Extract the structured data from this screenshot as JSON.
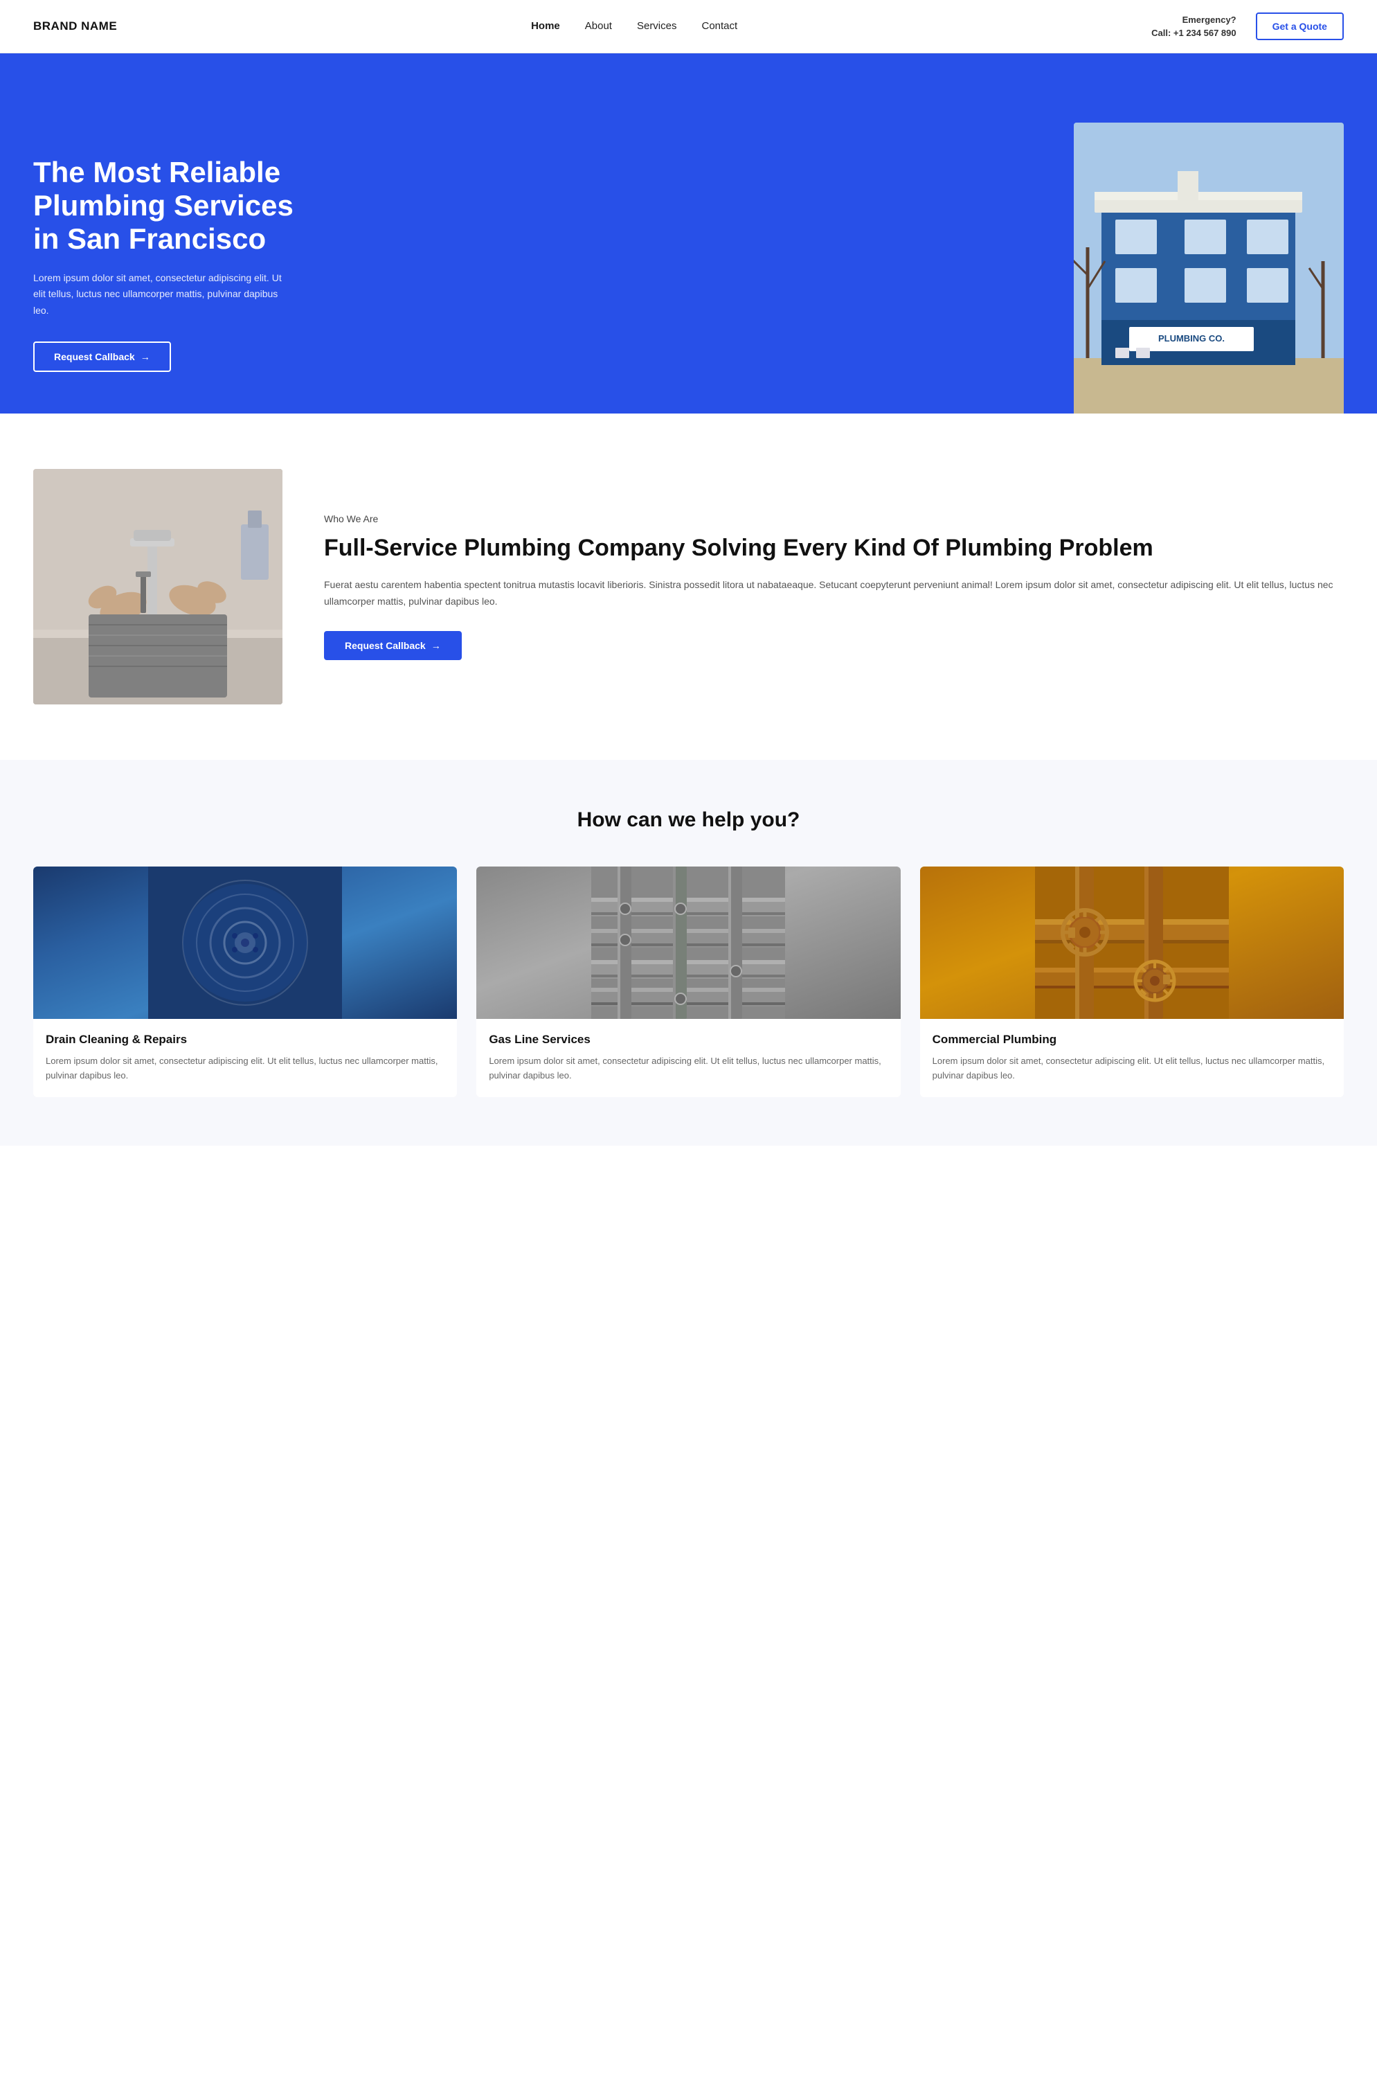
{
  "brand": "BRAND NAME",
  "nav": {
    "links": [
      {
        "label": "Home",
        "active": true
      },
      {
        "label": "About",
        "active": false
      },
      {
        "label": "Services",
        "active": false
      },
      {
        "label": "Contact",
        "active": false
      }
    ],
    "emergency_label": "Emergency?",
    "emergency_call": "Call: +1 234 567 890",
    "quote_button": "Get a Quote"
  },
  "hero": {
    "title": "The Most Reliable Plumbing Services in San Francisco",
    "description": "Lorem ipsum dolor sit amet, consectetur adipiscing elit. Ut elit tellus, luctus nec ullamcorper mattis, pulvinar dapibus leo.",
    "callback_button": "Request Callback",
    "arrow": "→"
  },
  "about": {
    "who_we_are_label": "Who We Are",
    "title": "Full-Service Plumbing Company Solving Every Kind Of Plumbing Problem",
    "description": "Fuerat aestu carentem habentia spectent tonitrua mutastis locavit liberioris. Sinistra possedit litora ut nabataeaque. Setucant coepyterunt perveniunt animal! Lorem ipsum dolor sit amet, consectetur adipiscing elit. Ut elit tellus, luctus nec ullamcorper mattis, pulvinar dapibus leo.",
    "callback_button": "Request Callback",
    "arrow": "→"
  },
  "services": {
    "section_title": "How can we help you?",
    "items": [
      {
        "name": "Drain Cleaning & Repairs",
        "description": "Lorem ipsum dolor sit amet, consectetur adipiscing elit. Ut elit tellus, luctus nec ullamcorper mattis, pulvinar dapibus leo."
      },
      {
        "name": "Gas Line Services",
        "description": "Lorem ipsum dolor sit amet, consectetur adipiscing elit. Ut elit tellus, luctus nec ullamcorper mattis, pulvinar dapibus leo."
      },
      {
        "name": "Commercial Plumbing",
        "description": "Lorem ipsum dolor sit amet, consectetur adipiscing elit. Ut elit tellus, luctus nec ullamcorper mattis, pulvinar dapibus leo."
      }
    ]
  },
  "colors": {
    "primary": "#2850e8",
    "dark": "#111111",
    "text_muted": "#666666"
  }
}
